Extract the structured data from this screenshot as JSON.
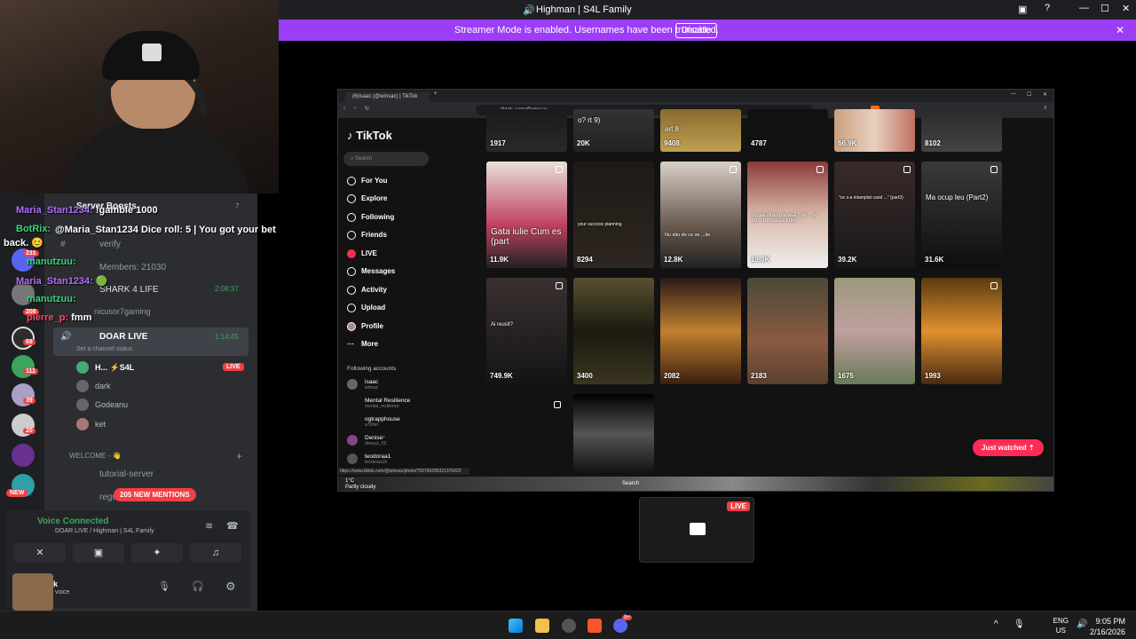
{
  "window": {
    "title": "Highman | S4L Family"
  },
  "streamer_banner": {
    "text": "Streamer Mode is enabled. Usernames have been truncated.",
    "button": "Disable"
  },
  "discord": {
    "server_header": "Server Boosts",
    "boost_count": "7",
    "members_label": "Members: 21030",
    "channels": [
      {
        "name": "verify"
      },
      {
        "name": "SHARK 4 LIFE",
        "time": "2:08:37"
      },
      {
        "name": "nicusor7gaming"
      },
      {
        "name": "DOAR LIVE",
        "time": "1:14:45",
        "status": "Set a channel status"
      }
    ],
    "voice_users": [
      {
        "name": "H... ⚡S4L",
        "live": "LIVE"
      },
      {
        "name": "dark"
      },
      {
        "name": "Godeanu"
      },
      {
        "name": "ket"
      }
    ],
    "category": "WELCOME - 👋",
    "text_channels": [
      "tutorial-server",
      "regu..."
    ],
    "new_badge": "NEW",
    "mentions_badge": "205 NEW MENTIONS",
    "voice_connected": {
      "title": "Voice Connected",
      "subtitle": "DOAR LIVE / Highman | S4L Family"
    },
    "user": {
      "name": "k",
      "status": "voice"
    },
    "server_badges": [
      "231",
      "208",
      "68",
      "111",
      "39",
      "20"
    ]
  },
  "chat_overlay": [
    {
      "user": "Maria_Stan1234:",
      "msg": "!gamble 1000",
      "color": "#b36bff"
    },
    {
      "user": "BotRix:",
      "msg": "@Maria_Stan1234 Dice roll: 5 | You got your bet back. 😊",
      "color": "#37d67a"
    },
    {
      "user": "manutzuu:",
      "msg": "",
      "color": "#37d67a"
    },
    {
      "user": "Maria_Stan1234:",
      "msg": "🟢",
      "color": "#b36bff"
    },
    {
      "user": "manutzuu:",
      "msg": "",
      "color": "#37d67a"
    },
    {
      "user": "pierre_p:",
      "msg": "fmm",
      "color": "#ff4a6a"
    }
  ],
  "browser": {
    "tab_title": "(6)isaac (@winsac) | TikTok",
    "url": "tiktok.com/@winsac",
    "status_url": "https://www.tiktok.com/@winsac/photo/759706395321376022"
  },
  "tiktok": {
    "brand": "TikTok",
    "search_placeholder": "Search",
    "nav": [
      "For You",
      "Explore",
      "Following",
      "Friends",
      "LIVE",
      "Messages",
      "Activity",
      "Upload",
      "Profile",
      "More"
    ],
    "following_header": "Following accounts",
    "accounts": [
      {
        "name": "isaac",
        "handle": "winsac"
      },
      {
        "name": "Mental Resilience",
        "handle": "mental_resilience"
      },
      {
        "name": "ogtrapphouse",
        "handle": "a7l0fel"
      },
      {
        "name": "Denise⁷",
        "handle": "deeyuz_02"
      },
      {
        "name": "teodoraa1",
        "handle": "teodoraa1h"
      }
    ],
    "top_row_counts": [
      "1917",
      "20K",
      "9408",
      "4787",
      "66.9K",
      "8102"
    ],
    "top_row_text": [
      "",
      "o? rt 9)",
      "art 8",
      "",
      "",
      ""
    ],
    "row2": [
      {
        "count": "11.9K",
        "text": "Gata iulie Cum es (part"
      },
      {
        "count": "8294",
        "text": "your success planning"
      },
      {
        "count": "12.8K",
        "text": "Nu stiu de ce se ...tie"
      },
      {
        "count": "19.3K",
        "text": "nu se intampla asa frati ...si cu o Ionica sa intre ..."
      },
      {
        "count": "39.2K",
        "text": "\"ce s-a intamplat cand ...\" (part3)"
      },
      {
        "count": "31.6K",
        "text": "Ma ocup leu (Part2)"
      }
    ],
    "row3": [
      {
        "count": "749.9K",
        "text": "Ai reusit?"
      },
      {
        "count": "3400",
        "text": ""
      },
      {
        "count": "2082",
        "text": ""
      },
      {
        "count": "2183",
        "text": ""
      },
      {
        "count": "1675",
        "text": ""
      },
      {
        "count": "1993",
        "text": ""
      }
    ],
    "just_watched": "Just watched",
    "taskbar_search": "Search",
    "weather": {
      "temp": "1°C",
      "desc": "Partly cloudy"
    }
  },
  "mini_live": "LIVE",
  "taskbar": {
    "lang": "ENG",
    "region": "US",
    "time": "9:05 PM",
    "date": "2/16/2026",
    "discord_badge": "9+"
  }
}
